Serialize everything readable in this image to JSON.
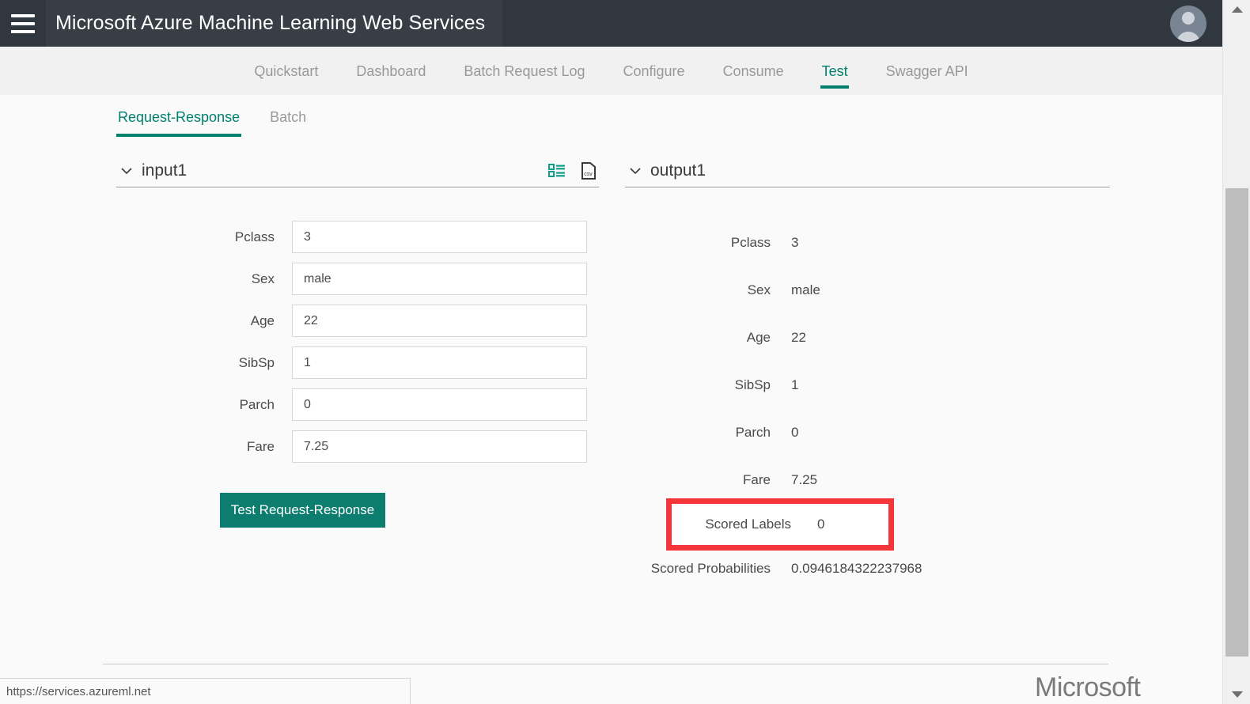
{
  "header": {
    "menu_icon": "hamburger-icon",
    "title": "Microsoft Azure Machine Learning Web Services",
    "avatar_icon": "user-avatar-icon",
    "background": "#30373f"
  },
  "nav": {
    "items": [
      {
        "label": "Quickstart",
        "active": false
      },
      {
        "label": "Dashboard",
        "active": false
      },
      {
        "label": "Batch Request Log",
        "active": false
      },
      {
        "label": "Configure",
        "active": false
      },
      {
        "label": "Consume",
        "active": false
      },
      {
        "label": "Test",
        "active": true
      },
      {
        "label": "Swagger API",
        "active": false
      }
    ],
    "accent": "#00806e"
  },
  "subtabs": {
    "items": [
      {
        "label": "Request-Response",
        "active": true
      },
      {
        "label": "Batch",
        "active": false
      }
    ]
  },
  "input_panel": {
    "title": "input1",
    "chevron_icon": "chevron-down-icon",
    "grid_icon": "grid-view-icon",
    "csv_icon": "csv-file-icon",
    "fields": [
      {
        "label": "Pclass",
        "value": "3"
      },
      {
        "label": "Sex",
        "value": "male"
      },
      {
        "label": "Age",
        "value": "22"
      },
      {
        "label": "SibSp",
        "value": "1"
      },
      {
        "label": "Parch",
        "value": "0"
      },
      {
        "label": "Fare",
        "value": "7.25"
      }
    ],
    "submit_label": "Test Request-Response",
    "submit_color": "#0c7d6f"
  },
  "output_panel": {
    "title": "output1",
    "chevron_icon": "chevron-down-icon",
    "rows": [
      {
        "label": "Pclass",
        "value": "3",
        "highlight": false
      },
      {
        "label": "Sex",
        "value": "male",
        "highlight": false
      },
      {
        "label": "Age",
        "value": "22",
        "highlight": false
      },
      {
        "label": "SibSp",
        "value": "1",
        "highlight": false
      },
      {
        "label": "Parch",
        "value": "0",
        "highlight": false
      },
      {
        "label": "Fare",
        "value": "7.25",
        "highlight": false
      },
      {
        "label": "Scored Labels",
        "value": "0",
        "highlight": true
      },
      {
        "label": "Scored Probabilities",
        "value": "0.0946184322237968",
        "highlight": false
      }
    ],
    "highlight_color": "#f4353a"
  },
  "footer": {
    "logo_text": "Microsoft"
  },
  "statusbar": {
    "url": "https://services.azureml.net"
  },
  "scrollbar": {
    "up_icon": "scroll-up-arrow-icon",
    "down_icon": "scroll-down-arrow-icon"
  }
}
